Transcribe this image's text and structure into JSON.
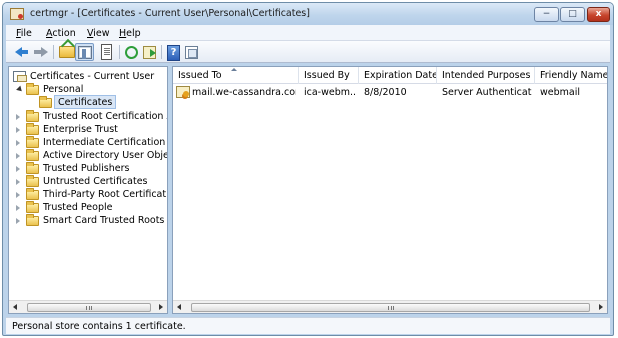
{
  "window": {
    "title": "certmgr - [Certificates - Current User\\Personal\\Certificates]",
    "controls": {
      "minimize": "−",
      "maximize": "□",
      "close": "x"
    }
  },
  "menu": {
    "items": [
      {
        "prefix": "",
        "accel": "F",
        "rest": "ile"
      },
      {
        "prefix": "",
        "accel": "A",
        "rest": "ction"
      },
      {
        "prefix": "",
        "accel": "V",
        "rest": "iew"
      },
      {
        "prefix": "",
        "accel": "H",
        "rest": "elp"
      }
    ]
  },
  "toolbar": {
    "icons": [
      "back-icon",
      "forward-icon",
      "up-level-icon",
      "show-hide-console-tree-icon",
      "properties-icon",
      "refresh-icon",
      "export-list-icon",
      "help-icon",
      "show-action-pane-icon"
    ]
  },
  "tree": {
    "root": "Certificates - Current User",
    "personal": "Personal",
    "selected": "Certificates",
    "stores": [
      "Trusted Root Certification Au",
      "Enterprise Trust",
      "Intermediate Certification Au",
      "Active Directory User Object",
      "Trusted Publishers",
      "Untrusted Certificates",
      "Third-Party Root Certification",
      "Trusted People",
      "Smart Card Trusted Roots"
    ]
  },
  "list": {
    "columns": [
      "Issued To",
      "Issued By",
      "Expiration Date",
      "Intended Purposes",
      "Friendly Name"
    ],
    "rows": [
      {
        "issued_to": "mail.we-cassandra.com",
        "issued_by": "ica-webm...",
        "expiration": "8/8/2010",
        "purposes": "Server Authenticati...",
        "friendly_name": "webmail"
      }
    ]
  },
  "status": {
    "text": "Personal store contains 1 certificate."
  },
  "scroll": {
    "grip": "III"
  }
}
